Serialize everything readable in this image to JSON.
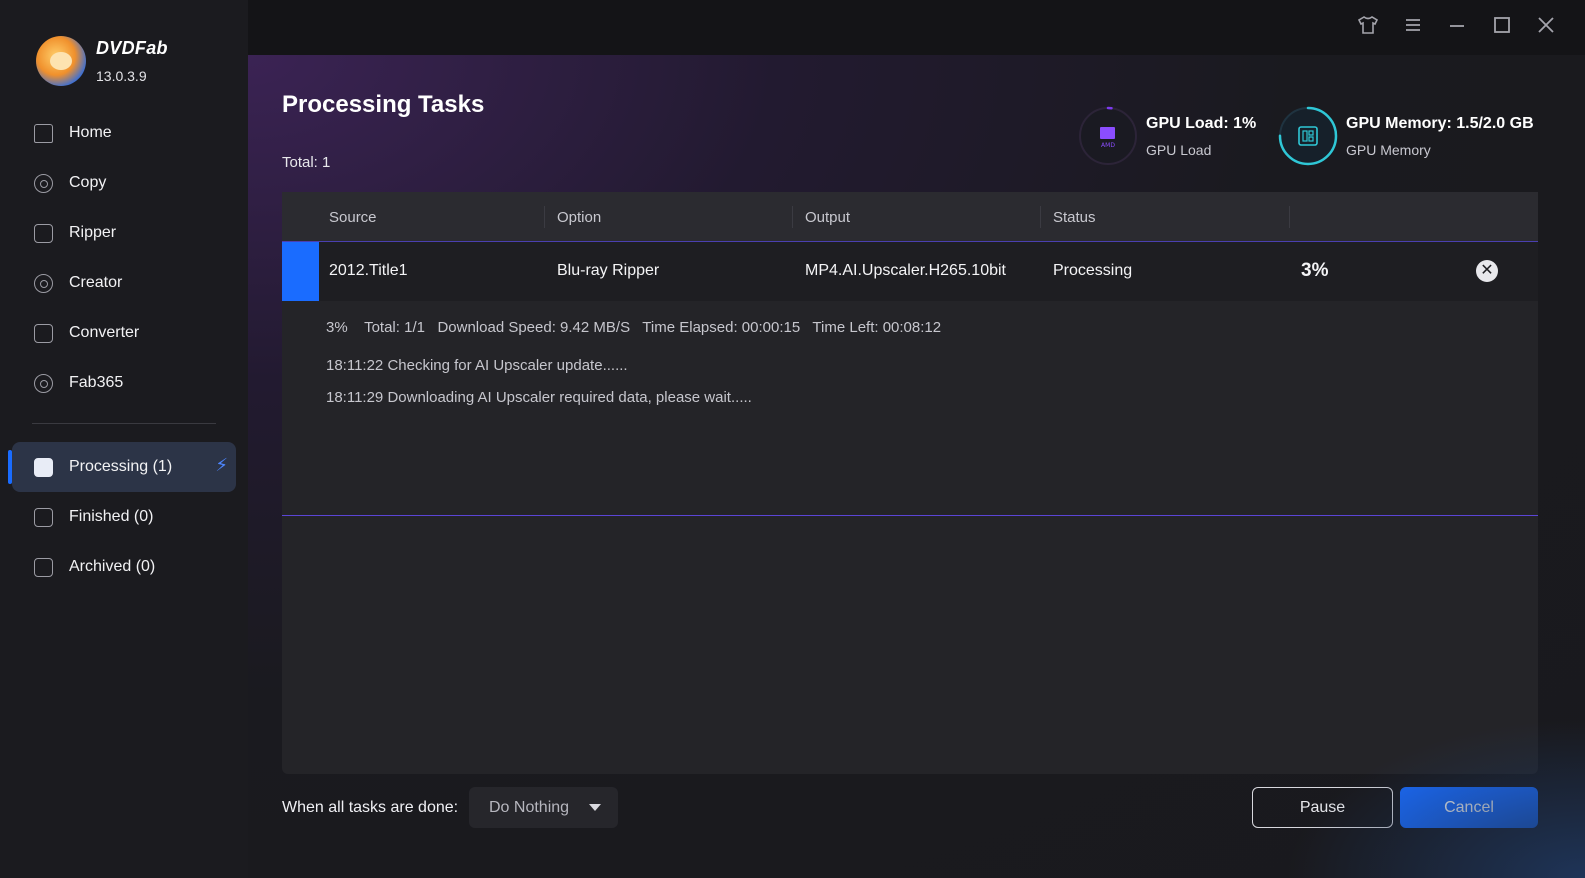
{
  "app": {
    "brand": "DVDFab",
    "version": "13.0.3.9"
  },
  "sidebar": {
    "items": [
      {
        "label": "Home",
        "icon": "home-icon"
      },
      {
        "label": "Copy",
        "icon": "copy-icon"
      },
      {
        "label": "Ripper",
        "icon": "ripper-icon"
      },
      {
        "label": "Creator",
        "icon": "creator-icon"
      },
      {
        "label": "Converter",
        "icon": "converter-icon"
      },
      {
        "label": "Fab365",
        "icon": "fab365-icon"
      }
    ],
    "tasks": [
      {
        "label": "Processing (1)",
        "icon": "processing-icon",
        "active": true
      },
      {
        "label": "Finished (0)",
        "icon": "finished-icon"
      },
      {
        "label": "Archived (0)",
        "icon": "archived-icon"
      }
    ]
  },
  "titlebar": {
    "icons": [
      "shirt-icon",
      "menu-icon",
      "minimize-icon",
      "maximize-icon",
      "close-icon"
    ]
  },
  "main": {
    "title": "Processing Tasks",
    "total": "Total: 1",
    "gpu_load": {
      "title": "GPU Load: 1%",
      "sub": "GPU Load",
      "percent": 1
    },
    "gpu_memory": {
      "title": "GPU Memory: 1.5/2.0 GB",
      "sub": "GPU Memory",
      "percent": 75
    },
    "table": {
      "headers": [
        "Source",
        "Option",
        "Output",
        "Status"
      ],
      "row": {
        "source": "2012.Title1",
        "option": "Blu-ray Ripper",
        "output": "MP4.AI.Upscaler.H265.10bit",
        "status": "Processing",
        "progress": "3%"
      },
      "detail": {
        "summary": "3%    Total: 1/1   Download Speed: 9.42 MB/S   Time Elapsed: 00:00:15   Time Left: 00:08:12",
        "logs": [
          "18:11:22  Checking for AI Upscaler update......",
          "18:11:29  Downloading AI Upscaler required data, please wait....."
        ]
      }
    },
    "footer": {
      "when_done_label": "When all tasks are done:",
      "when_done_value": "Do Nothing",
      "pause_label": "Pause",
      "cancel_label": "Cancel"
    }
  },
  "colors": {
    "accent": "#1a6cff",
    "gpu_memory_ring": "#2fc7d6",
    "gpu_load_ring": "#7c3aed"
  }
}
